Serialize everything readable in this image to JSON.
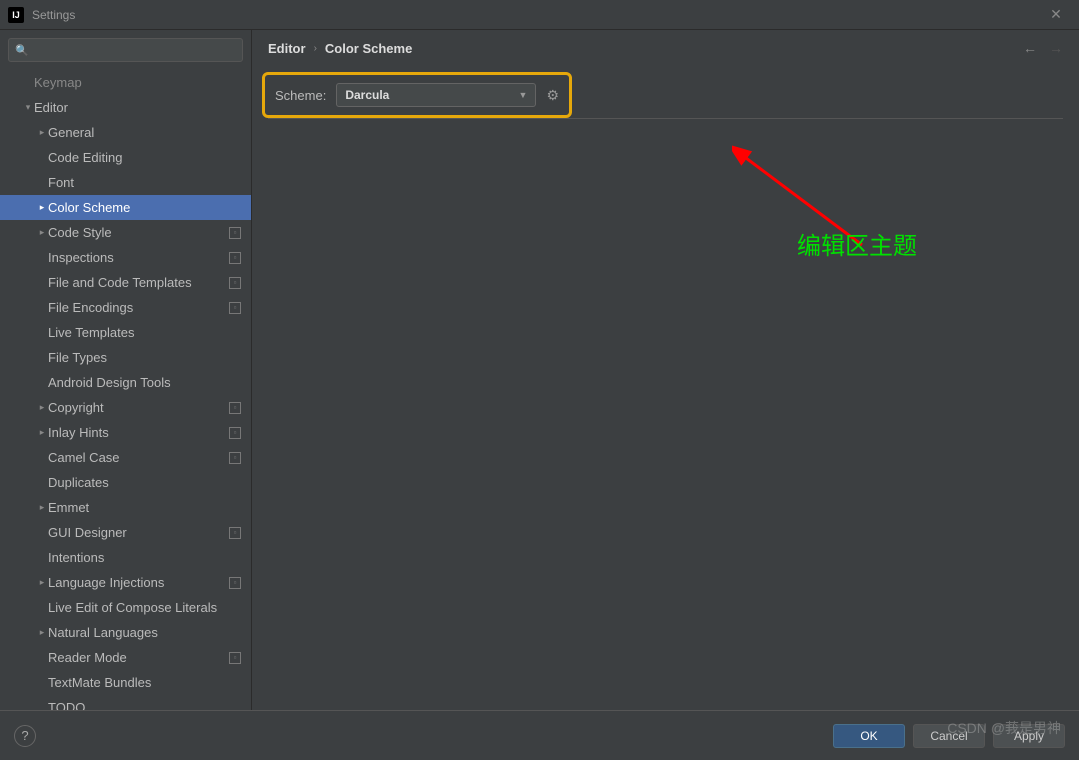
{
  "window": {
    "title": "Settings",
    "app_icon": "IJ"
  },
  "search": {
    "placeholder": ""
  },
  "breadcrumb": {
    "a": "Editor",
    "b": "Color Scheme"
  },
  "scheme": {
    "label": "Scheme:",
    "value": "Darcula"
  },
  "tree": [
    {
      "label": "Keymap",
      "level": 1,
      "arrow": "",
      "dim": true
    },
    {
      "label": "Editor",
      "level": 1,
      "arrow": "v"
    },
    {
      "label": "General",
      "level": 2,
      "arrow": ">"
    },
    {
      "label": "Code Editing",
      "level": 2,
      "arrow": ""
    },
    {
      "label": "Font",
      "level": 2,
      "arrow": ""
    },
    {
      "label": "Color Scheme",
      "level": 2,
      "arrow": ">",
      "selected": true
    },
    {
      "label": "Code Style",
      "level": 2,
      "arrow": ">",
      "badge": true
    },
    {
      "label": "Inspections",
      "level": 2,
      "arrow": "",
      "badge": true
    },
    {
      "label": "File and Code Templates",
      "level": 2,
      "arrow": "",
      "badge": true
    },
    {
      "label": "File Encodings",
      "level": 2,
      "arrow": "",
      "badge": true
    },
    {
      "label": "Live Templates",
      "level": 2,
      "arrow": ""
    },
    {
      "label": "File Types",
      "level": 2,
      "arrow": ""
    },
    {
      "label": "Android Design Tools",
      "level": 2,
      "arrow": ""
    },
    {
      "label": "Copyright",
      "level": 2,
      "arrow": ">",
      "badge": true
    },
    {
      "label": "Inlay Hints",
      "level": 2,
      "arrow": ">",
      "badge": true
    },
    {
      "label": "Camel Case",
      "level": 2,
      "arrow": "",
      "badge": true
    },
    {
      "label": "Duplicates",
      "level": 2,
      "arrow": ""
    },
    {
      "label": "Emmet",
      "level": 2,
      "arrow": ">"
    },
    {
      "label": "GUI Designer",
      "level": 2,
      "arrow": "",
      "badge": true
    },
    {
      "label": "Intentions",
      "level": 2,
      "arrow": ""
    },
    {
      "label": "Language Injections",
      "level": 2,
      "arrow": ">",
      "badge": true
    },
    {
      "label": "Live Edit of Compose Literals",
      "level": 2,
      "arrow": ""
    },
    {
      "label": "Natural Languages",
      "level": 2,
      "arrow": ">"
    },
    {
      "label": "Reader Mode",
      "level": 2,
      "arrow": "",
      "badge": true
    },
    {
      "label": "TextMate Bundles",
      "level": 2,
      "arrow": ""
    },
    {
      "label": "TODO",
      "level": 2,
      "arrow": ""
    }
  ],
  "annotation": {
    "text": "编辑区主题"
  },
  "buttons": {
    "ok": "OK",
    "cancel": "Cancel",
    "apply": "Apply"
  },
  "watermark": "CSDN @莪是男神"
}
